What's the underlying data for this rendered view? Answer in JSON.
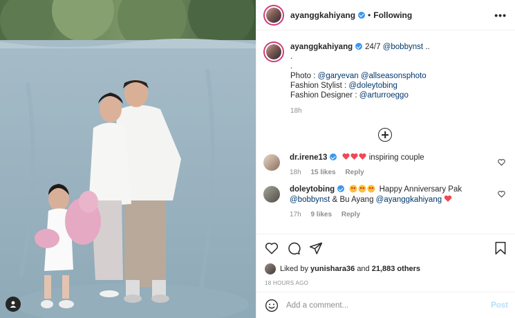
{
  "header": {
    "username": "ayanggkahiyang",
    "separator": "•",
    "following_label": "Following",
    "more_label": "•••"
  },
  "caption": {
    "username": "ayanggkahiyang",
    "text": "24/7",
    "mention_main": "@bobbynst",
    "ellipsis": "..",
    "dot1": ".",
    "dot2": ".",
    "photo_label": "Photo : ",
    "photo_m1": "@garyevan",
    "photo_m2": "@allseasonsphoto",
    "stylist_label": "Fashion Stylist : ",
    "stylist_m": "@doleytobing",
    "designer_label": "Fashion Designer : ",
    "designer_m": "@arturroeggo",
    "time": "18h"
  },
  "comments": [
    {
      "username": "dr.irene13",
      "text": "inspiring couple",
      "time": "18h",
      "likes": "15 likes",
      "reply": "Reply"
    },
    {
      "username": "doleytobing",
      "text_a": "Happy Anniversary Pak",
      "mention_a": "@bobbynst",
      "text_b": "&",
      "text_c": "Bu Ayang",
      "mention_b": "@ayanggkahiyang",
      "time": "17h",
      "likes": "9 likes",
      "reply": "Reply"
    }
  ],
  "likes": {
    "prefix": "Liked by",
    "user": "yunishara36",
    "middle": "and",
    "count": "21,883 others"
  },
  "time_ago": "18 HOURS AGO",
  "add_comment": {
    "placeholder": "Add a comment...",
    "post_label": "Post"
  },
  "colors": {
    "link": "#00376b",
    "verified": "#3897f0",
    "heart": "#ed4956",
    "post_disabled": "#b2dffc",
    "backdrop": "#9fb6c3"
  }
}
